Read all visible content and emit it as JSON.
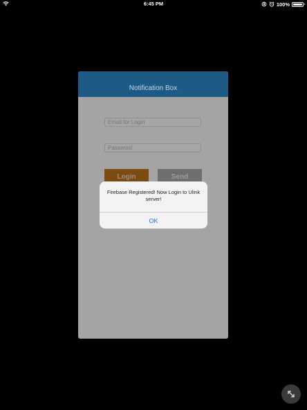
{
  "status_bar": {
    "time": "6:45 PM",
    "battery_percent": "100%",
    "battery_level": 1.0
  },
  "app": {
    "title": "Notification Box",
    "email_placeholder": "Email for Login",
    "password_placeholder": "Password",
    "login_label": "Login",
    "send_label": "Send"
  },
  "alert": {
    "message": "Firebase Registered! Now Login to Ulink server!",
    "ok_label": "OK"
  },
  "icons": {
    "wifi": "wifi-icon",
    "orientation_lock": "orientation-lock-icon",
    "alarm": "alarm-icon",
    "battery": "battery-icon",
    "expand": "expand-icon"
  },
  "colors": {
    "header": "#1e5a86",
    "login_button": "#7c4b12",
    "send_button": "#6e6e6e",
    "alert_action": "#1f6fd6",
    "background": "#000000"
  }
}
